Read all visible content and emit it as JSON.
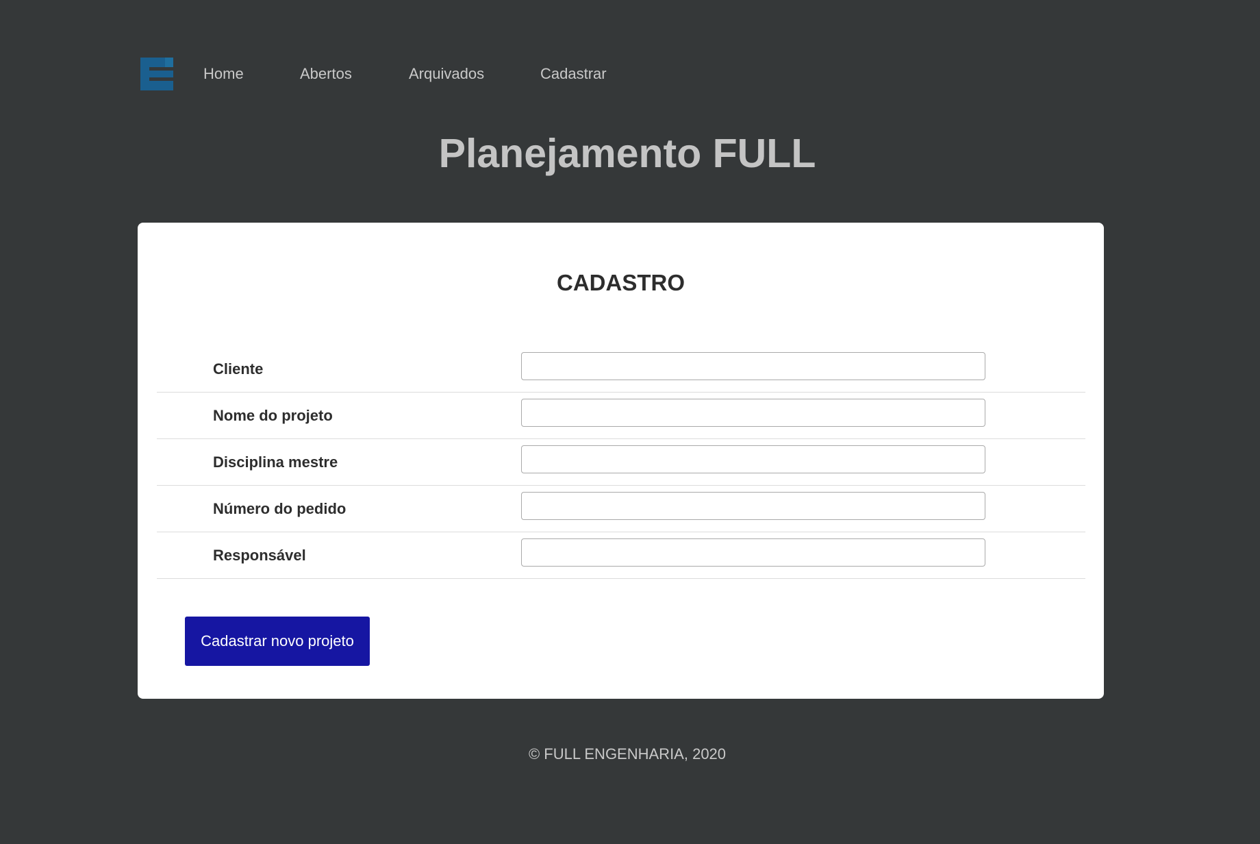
{
  "nav": {
    "logo_name": "full-engenharia-logo",
    "items": [
      {
        "label": "Home"
      },
      {
        "label": "Abertos"
      },
      {
        "label": "Arquivados"
      },
      {
        "label": "Cadastrar"
      }
    ]
  },
  "header": {
    "title": "Planejamento FULL"
  },
  "form": {
    "title": "CADASTRO",
    "fields": [
      {
        "label": "Cliente",
        "value": "",
        "placeholder": ""
      },
      {
        "label": "Nome do projeto",
        "value": "",
        "placeholder": ""
      },
      {
        "label": "Disciplina mestre",
        "value": "",
        "placeholder": ""
      },
      {
        "label": "Número do pedido",
        "value": "",
        "placeholder": ""
      },
      {
        "label": "Responsável",
        "value": "",
        "placeholder": ""
      }
    ],
    "submit_label": "Cadastrar novo projeto"
  },
  "footer": {
    "text": "© FULL ENGENHARIA, 2020"
  },
  "colors": {
    "background": "#353839",
    "logo": "#1a5f8f",
    "button": "#1616a2",
    "card": "#ffffff"
  }
}
